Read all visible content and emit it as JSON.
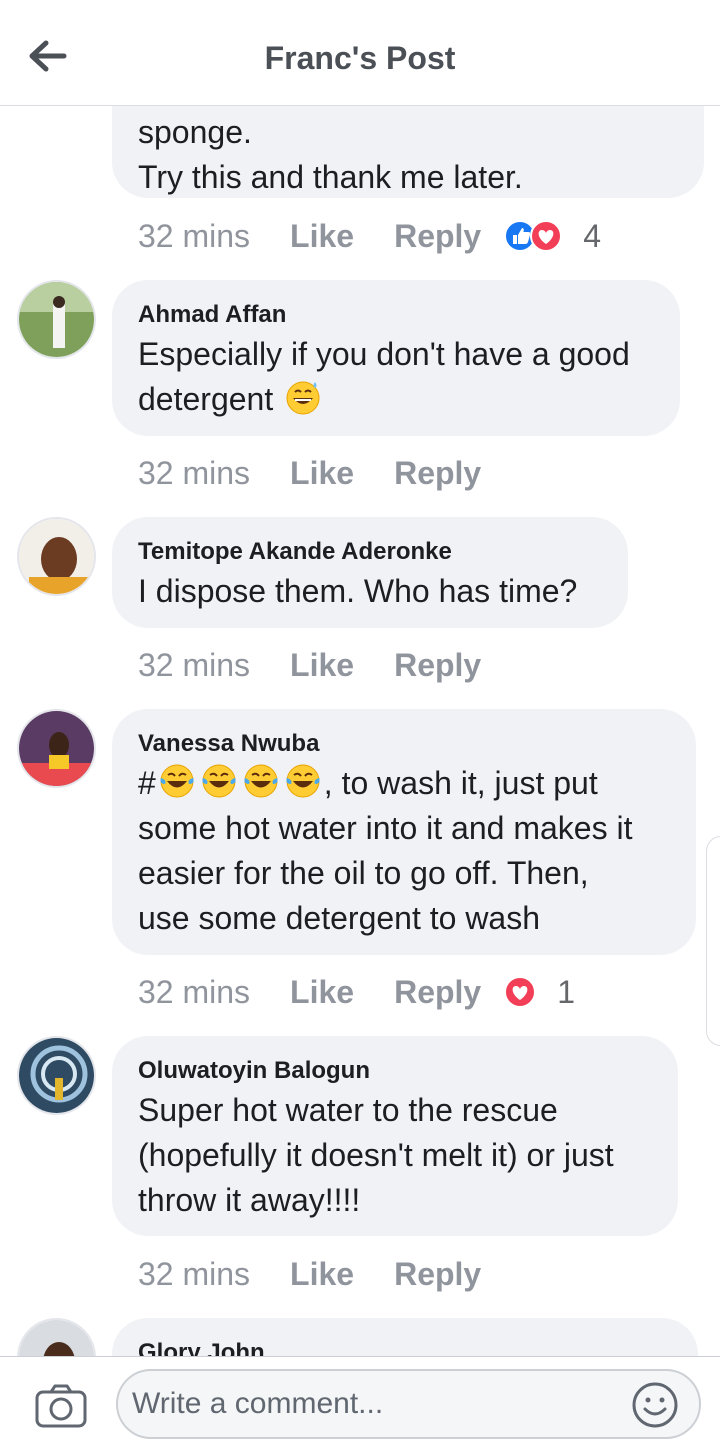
{
  "header": {
    "title": "Franc's Post",
    "back_icon": "arrow-left-icon"
  },
  "partial_comment": {
    "lines": [
      "sponge.",
      "Try this and thank me later."
    ],
    "time": "32 mins",
    "like": "Like",
    "reply": "Reply",
    "reaction_count": "4",
    "reactions": [
      "like",
      "love"
    ]
  },
  "comments": [
    {
      "author": "Ahmad Affan",
      "lines": [
        "Especially if you don't have a good",
        "detergent"
      ],
      "emoji": "grinning-sweat-emoji",
      "time": "32 mins",
      "like": "Like",
      "reply": "Reply"
    },
    {
      "author": "Temitope Akande Aderonke",
      "lines": [
        "I dispose them. Who has time?"
      ],
      "time": "32 mins",
      "like": "Like",
      "reply": "Reply"
    },
    {
      "author": "Vanessa Nwuba",
      "lines": [
        "#",
        ", to wash it, just put",
        "some hot water into it and makes it",
        "easier for the oil to go off. Then,",
        "use some detergent to wash"
      ],
      "emoji": "tears-of-joy-emoji",
      "time": "32 mins",
      "like": "Like",
      "reply": "Reply",
      "reaction_count": "1",
      "reactions": [
        "love"
      ]
    },
    {
      "author": "Oluwatoyin Balogun",
      "lines": [
        "Super hot water to the rescue",
        "(hopefully it doesn't melt it) or just",
        "throw it away!!!!"
      ],
      "time": "32 mins",
      "like": "Like",
      "reply": "Reply"
    },
    {
      "author": "Glory John"
    }
  ],
  "composer": {
    "placeholder": "Write a comment...",
    "camera_icon": "camera-icon",
    "emoji_icon": "smiley-icon"
  },
  "colors": {
    "bubble": "#f0f2f5",
    "meta": "#90949c",
    "like_blue": "#1877f2",
    "love_red": "#f33e58"
  }
}
